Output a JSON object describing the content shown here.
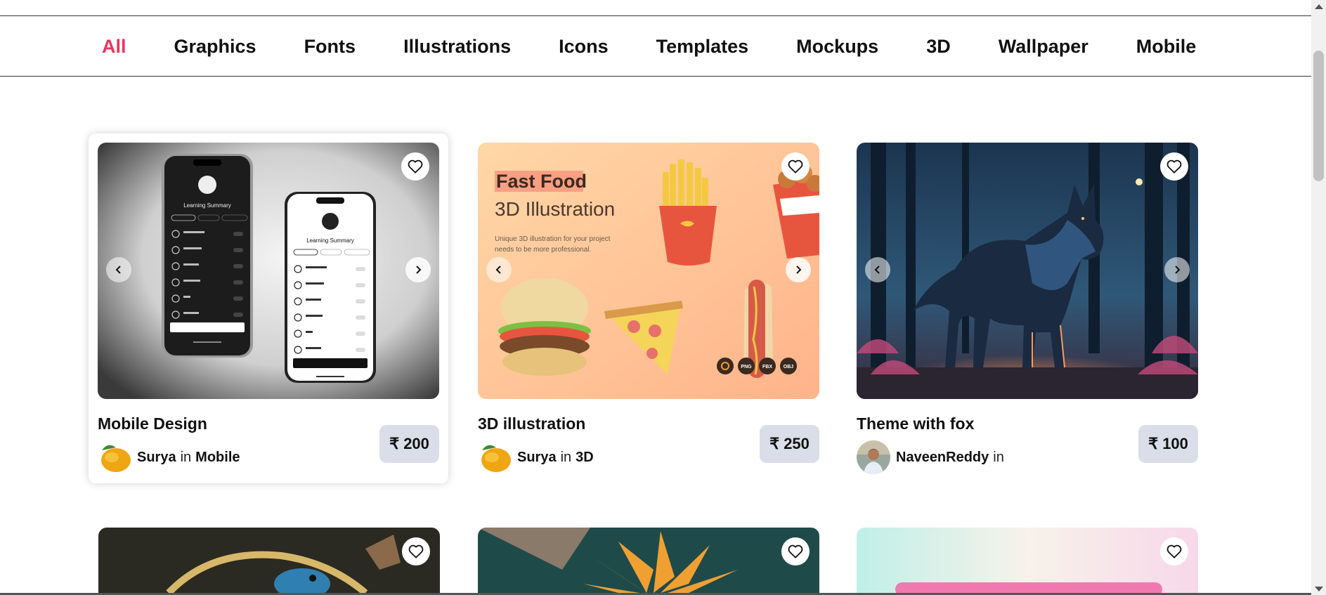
{
  "nav": {
    "items": [
      {
        "label": "All",
        "active": true
      },
      {
        "label": "Graphics"
      },
      {
        "label": "Fonts"
      },
      {
        "label": "Illustrations"
      },
      {
        "label": "Icons"
      },
      {
        "label": "Templates"
      },
      {
        "label": "Mockups"
      },
      {
        "label": "3D"
      },
      {
        "label": "Wallpaper"
      },
      {
        "label": "Mobile"
      }
    ],
    "accent_color": "#e8365d"
  },
  "cards": [
    {
      "title": "Mobile Design",
      "author": "Surya",
      "in": "in",
      "category": "Mobile",
      "price": "₹ 200",
      "phone_title": "Learning Summary"
    },
    {
      "title": "3D illustration",
      "author": "Surya",
      "in": "in",
      "category": "3D",
      "price": "₹ 250",
      "image_heading": "Fast Food",
      "image_subheading": "3D Illustration",
      "image_caption_1": "Unique 3D illustration for your project",
      "image_caption_2": "needs to be more professional.",
      "formats": [
        "PNG",
        "FBX",
        "OBJ"
      ]
    },
    {
      "title": "Theme with fox",
      "author": "NaveenReddy",
      "in": "in",
      "category": "",
      "price": "₹ 100"
    }
  ],
  "colors": {
    "price_bg": "#d9dee8",
    "nav_text": "#111111"
  },
  "icons": {
    "favorite": "heart-icon",
    "prev": "chevron-left-icon",
    "next": "chevron-right-icon"
  }
}
